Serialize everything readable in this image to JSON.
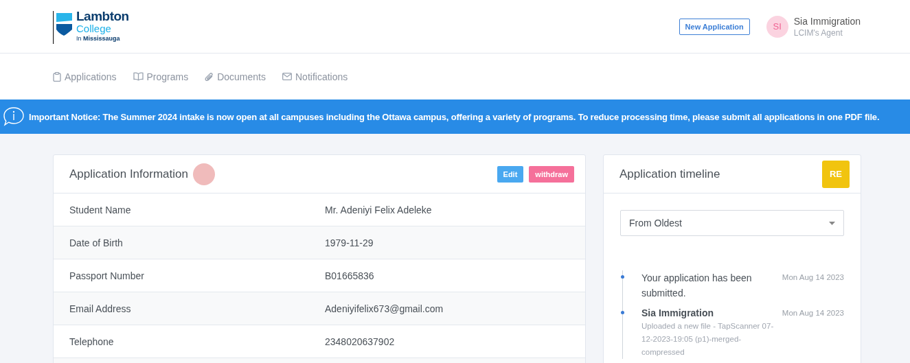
{
  "header": {
    "logo": {
      "name": "Lambton",
      "subtitle": "College",
      "campus": "In **Mississauga**"
    },
    "new_application_button": "New Application",
    "user": {
      "initials": "SI",
      "name": "Sia Immigration",
      "role": "LCIM's Agent"
    }
  },
  "nav": [
    {
      "label": "Applications",
      "kind": "clipboard"
    },
    {
      "label": "Programs",
      "kind": "book"
    },
    {
      "label": "Documents",
      "kind": "paperclip"
    },
    {
      "label": "Notifications",
      "kind": "mail"
    }
  ],
  "notice": "Important Notice: The Summer 2024 intake is now open at all campuses including the Ottawa campus, offering a variety of programs. To reduce processing time, please submit all applications in one PDF file.",
  "application_info": {
    "title": "Application Information",
    "buttons": [
      {
        "label": "Edit",
        "kind": "primary"
      },
      {
        "label": "withdraw",
        "kind": "danger"
      }
    ],
    "rows": [
      {
        "label": "Student Name",
        "value": "Mr. Adeniyi Felix Adeleke"
      },
      {
        "label": "Date of Birth",
        "value": "1979-11-29"
      },
      {
        "label": "Passport Number",
        "value": "B01665836"
      },
      {
        "label": "Email Address",
        "value": "Adeniyifelix673@gmail.com"
      },
      {
        "label": "Telephone",
        "value": "2348020637902"
      }
    ]
  },
  "timeline": {
    "title": "Application timeline",
    "badge": "RE",
    "sort": {
      "value": "From Oldest"
    },
    "items": [
      {
        "kind": "event",
        "text": "Your application has been submitted.",
        "date": "Mon Aug 14 2023"
      },
      {
        "kind": "upload",
        "title": "Sia Immigration",
        "text": "Uploaded a new file - TapScanner 07-12-2023-19:05 (p1)-merged-compressed",
        "date": "Mon Aug 14 2023"
      }
    ]
  }
}
